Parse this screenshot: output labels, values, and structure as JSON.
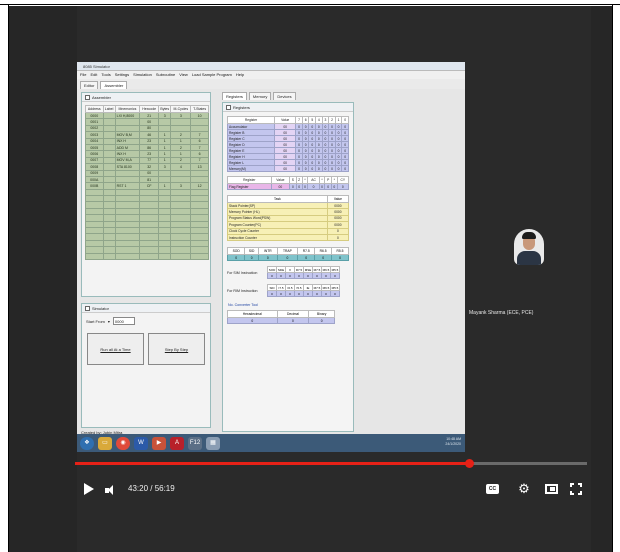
{
  "app": {
    "window_title": "8085 Simulator",
    "menu": [
      "File",
      "Edit",
      "Tools",
      "Settings",
      "Simulation",
      "Subroutine",
      "View",
      "Load Sample Program",
      "Help"
    ],
    "tabs": [
      "Editor",
      "Assembler"
    ],
    "right_tabs": [
      "Registers",
      "Memory",
      "Devices"
    ]
  },
  "assembler": {
    "title": "Assembler",
    "headers": [
      "Address",
      "Label",
      "Mnemonics",
      "Hexcode",
      "Bytes",
      "M-Cycles",
      "T-States"
    ],
    "rows": [
      [
        "0000",
        "",
        "LXI H,8000",
        "21",
        "3",
        "3",
        "10"
      ],
      [
        "0001",
        "",
        "",
        "00",
        "",
        "",
        ""
      ],
      [
        "0002",
        "",
        "",
        "80",
        "",
        "",
        ""
      ],
      [
        "0003",
        "",
        "MOV B,M",
        "46",
        "1",
        "2",
        "7"
      ],
      [
        "0004",
        "",
        "INX H",
        "23",
        "1",
        "1",
        "6"
      ],
      [
        "0005",
        "",
        "ADD M",
        "86",
        "1",
        "2",
        "7"
      ],
      [
        "0006",
        "",
        "INX H",
        "23",
        "1",
        "1",
        "6"
      ],
      [
        "0007",
        "",
        "MOV M,A",
        "77",
        "1",
        "2",
        "7"
      ],
      [
        "0008",
        "",
        "STA 8100",
        "32",
        "3",
        "4",
        "13"
      ],
      [
        "0009",
        "",
        "",
        "00",
        "",
        "",
        ""
      ],
      [
        "000A",
        "",
        "",
        "81",
        "",
        "",
        ""
      ],
      [
        "000B",
        "",
        "RST 1",
        "CF",
        "1",
        "3",
        "12"
      ]
    ]
  },
  "simulator": {
    "title": "Simulator",
    "start_label": "Start From",
    "start_value": "0000",
    "run_all_label": "Run all At a Time",
    "step_label": "Step By Step"
  },
  "registers": {
    "title": "Registers",
    "headers": [
      "Register",
      "Value",
      "7",
      "6",
      "5",
      "4",
      "3",
      "2",
      "1",
      "0"
    ],
    "rows": [
      [
        "Accumulator",
        "00",
        "0",
        "0",
        "0",
        "0",
        "0",
        "0",
        "0",
        "0"
      ],
      [
        "Register B",
        "00",
        "0",
        "0",
        "0",
        "0",
        "0",
        "0",
        "0",
        "0"
      ],
      [
        "Register C",
        "00",
        "0",
        "0",
        "0",
        "0",
        "0",
        "0",
        "0",
        "0"
      ],
      [
        "Register D",
        "00",
        "0",
        "0",
        "0",
        "0",
        "0",
        "0",
        "0",
        "0"
      ],
      [
        "Register E",
        "00",
        "0",
        "0",
        "0",
        "0",
        "0",
        "0",
        "0",
        "0"
      ],
      [
        "Register H",
        "00",
        "0",
        "0",
        "0",
        "0",
        "0",
        "0",
        "0",
        "0"
      ],
      [
        "Register L",
        "00",
        "0",
        "0",
        "0",
        "0",
        "0",
        "0",
        "0",
        "0"
      ],
      [
        "Memory(M)",
        "00",
        "0",
        "0",
        "0",
        "0",
        "0",
        "0",
        "0",
        "0"
      ]
    ],
    "flag_headers": [
      "Register",
      "Value",
      "S",
      "Z",
      "*",
      "AC",
      "*",
      "P",
      "*",
      "CY"
    ],
    "flag_row": [
      "Flag Register",
      "00",
      "0",
      "0",
      "0",
      "0",
      "0",
      "0",
      "0",
      "0"
    ]
  },
  "system": {
    "headers": [
      "Task",
      "Value"
    ],
    "rows": [
      [
        "Stack Pointer(SP)",
        "0000"
      ],
      [
        "Memory Pointer (HL)",
        "0000"
      ],
      [
        "Program Status Word(PSW)",
        "0000"
      ],
      [
        "Program Counter(PC)",
        "0000"
      ],
      [
        "Clock Cycle Counter",
        "0"
      ],
      [
        "Instruction Counter",
        "0"
      ]
    ]
  },
  "interrupts": {
    "headers": [
      "SOD",
      "SID",
      "INTR",
      "TRAP",
      "R7.5",
      "R6.5",
      "R5.5"
    ],
    "values": [
      "0",
      "0",
      "0",
      "0",
      "0",
      "0",
      "0"
    ]
  },
  "sim_mode": {
    "sim_label": "For SIM Instruction",
    "sim_headers": [
      "SOD",
      "SDE",
      "X",
      "R7.5",
      "MSE",
      "M7.5",
      "M6.5",
      "M5.5"
    ],
    "sim_values": [
      "0",
      "0",
      "0",
      "0",
      "0",
      "0",
      "0",
      "0"
    ],
    "rim_label": "For RIM Instruction",
    "rim_headers": [
      "SID",
      "I7.5",
      "I6.5",
      "I5.5",
      "IE",
      "M7.5",
      "M6.5",
      "M5.5"
    ],
    "rim_values": [
      "0",
      "0",
      "0",
      "0",
      "0",
      "0",
      "0",
      "0"
    ]
  },
  "converter": {
    "label": "No. Converter Tool",
    "headers": [
      "Hexadecimal",
      "Decimal",
      "Binary"
    ],
    "values": [
      "0",
      "0",
      "0"
    ]
  },
  "footer": {
    "created_by": "Created by: Jubin Mitra",
    "clock_time": "10:48 AM",
    "clock_date": "24/1/2020"
  },
  "taskbar": {
    "icons": [
      "windows-start",
      "file-explorer",
      "chrome",
      "word",
      "media",
      "acrobat",
      "f12",
      "app"
    ]
  },
  "participant": {
    "name": "Mayank Sharma (ECE, PCE)"
  },
  "player": {
    "time_current": "43:20",
    "time_total": "56:19",
    "time_display": "43:20 / 56:19",
    "progress": 0.77,
    "cc_label": "CC",
    "accent": "#e62117"
  }
}
